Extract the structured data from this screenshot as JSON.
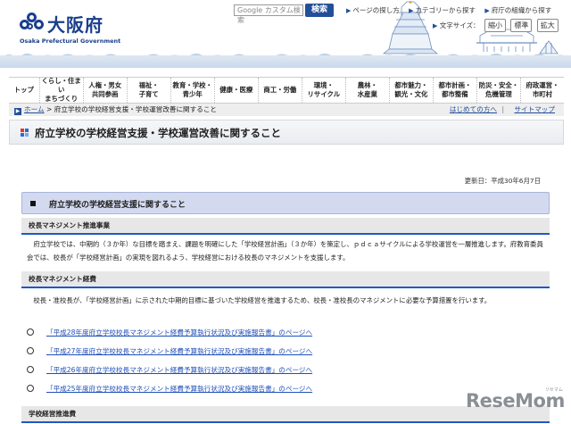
{
  "header": {
    "logo_name": "大阪府",
    "logo_en": "Osaka Prefectural Government",
    "search_placeholder": "Google カスタム検索",
    "search_button": "検索",
    "top_links": [
      "ページの探し方",
      "カテゴリーから探す",
      "府庁の組織から探す"
    ],
    "font_size_label": "文字サイズ：",
    "font_size_options": [
      "縮小",
      "標準",
      "拡大"
    ]
  },
  "nav": [
    "トップ",
    "くらし・住まい\nまちづくり",
    "人権・男女\n共同参画",
    "福祉・\n子育て",
    "教育・学校・\n青少年",
    "健康・医療",
    "商工・労働",
    "環境・\nリサイクル",
    "農林・\n水産業",
    "都市魅力・\n観光・文化",
    "都市計画・\n都市整備",
    "防災・安全・\n危機管理",
    "府政運営・\n市町村"
  ],
  "breadcrumb": {
    "home": "ホーム",
    "separator": ">",
    "current": "府立学校の学校経営支援・学校運営改善に関すること",
    "right_links": [
      "はじめての方へ",
      "サイトマップ"
    ],
    "right_separator": "|"
  },
  "page_title": "府立学校の学校経営支援・学校運営改善に関すること",
  "updated": "更新日：平成30年6月7日",
  "section_title": "府立学校の学校経営支援に関すること",
  "subsections": [
    {
      "title": "校長マネジメント推進事業",
      "text": "　府立学校では、中期的（３か年）な目標を踏まえ、課題を明確にした「学校経営計画」（３か年）を策定し、ｐｄｃａサイクルによる学校運営を一層推進します。府教育委員会では、校長が「学校経営計画」の実現を図れるよう、学校経営における校長のマネジメントを支援します。"
    },
    {
      "title": "校長マネジメント経費",
      "text": "　校長・准校長が、「学校経営計画」に示された中期的目標に基づいた学校経営を推進するため、校長・准校長のマネジメントに必要な予算措置を行います。"
    },
    {
      "title": "学校経営推進費"
    }
  ],
  "links": [
    "「平成28年度府立学校校長マネジメント経費予算執行状況及び実施報告書」のページへ",
    "「平成27年度府立学校校長マネジメント経費予算執行状況及び実施報告書」のページへ",
    "「平成26年度府立学校校長マネジメント経費予算執行状況及び実施報告書」のページへ",
    "「平成25年度府立学校校長マネジメント経費予算執行状況及び実施報告書」のページへ"
  ],
  "watermark": {
    "main": "ReseMom",
    "sub": "リセマム"
  },
  "colors": {
    "brand_blue": "#1a3f8c",
    "link_blue": "#1f4fb8",
    "section_bg": "#d3daf0",
    "subhead_rule": "#1f58c8"
  }
}
